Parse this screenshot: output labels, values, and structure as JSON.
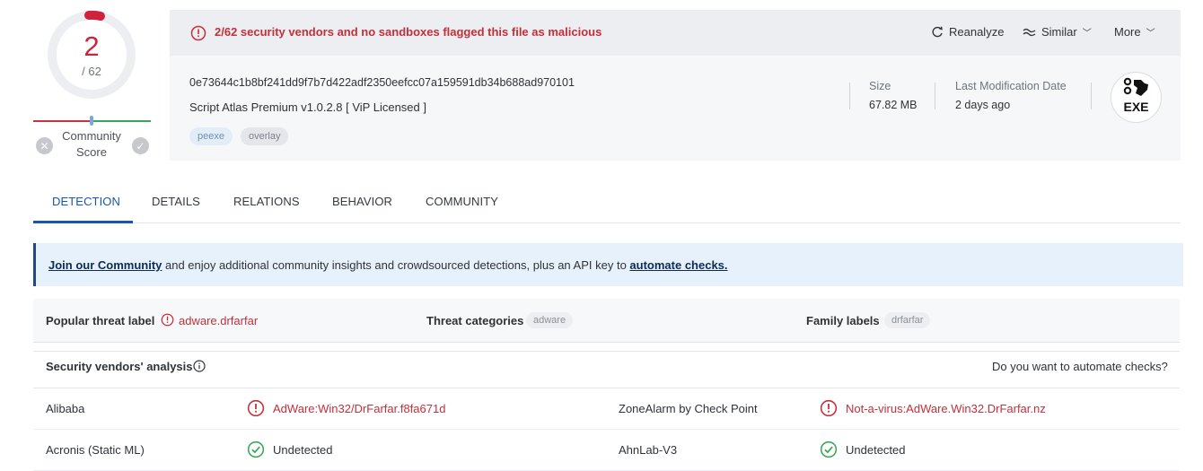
{
  "score": {
    "detected": "2",
    "total": "/ 62",
    "community_label_1": "Community",
    "community_label_2": "Score"
  },
  "alert": {
    "text": "2/62 security vendors and no sandboxes flagged this file as malicious"
  },
  "actions": {
    "reanalyze": "Reanalyze",
    "similar": "Similar",
    "more": "More"
  },
  "file": {
    "hash": "0e73644c1b8bf241dd9f7b7d422adf2350eefcc07a159591db34b688ad970101",
    "name": "Script Atlas Premium v1.0.2.8 [ ViP Licensed ]",
    "tags": [
      "peexe",
      "overlay"
    ],
    "size_label": "Size",
    "size_value": "67.82 MB",
    "date_label": "Last Modification Date",
    "date_value": "2 days ago",
    "type_badge": "EXE"
  },
  "tabs": [
    "DETECTION",
    "DETAILS",
    "RELATIONS",
    "BEHAVIOR",
    "COMMUNITY"
  ],
  "banner": {
    "join_link": "Join our Community",
    "middle_text": " and enjoy additional community insights and crowdsourced detections, plus an API key to ",
    "automate_link": "automate checks."
  },
  "threat": {
    "popular_label": "Popular threat label",
    "popular_value": "adware.drfarfar",
    "categories_label": "Threat categories",
    "categories_value": "adware",
    "family_label": "Family labels",
    "family_value": "drfarfar"
  },
  "vendors": {
    "heading": "Security vendors' analysis",
    "automate_prompt": "Do you want to automate checks?",
    "rows": [
      {
        "left_vendor": "Alibaba",
        "left_result": "AdWare:Win32/DrFarfar.f8fa671d",
        "left_status": "malicious",
        "right_vendor": "ZoneAlarm by Check Point",
        "right_result": "Not-a-virus:AdWare.Win32.DrFarfar.nz",
        "right_status": "malicious"
      },
      {
        "left_vendor": "Acronis (Static ML)",
        "left_result": "Undetected",
        "left_status": "clean",
        "right_vendor": "AhnLab-V3",
        "right_result": "Undetected",
        "right_status": "clean"
      }
    ]
  },
  "colors": {
    "malicious": "#c42f39",
    "clean": "#3aa757",
    "accent": "#1a56a8"
  }
}
